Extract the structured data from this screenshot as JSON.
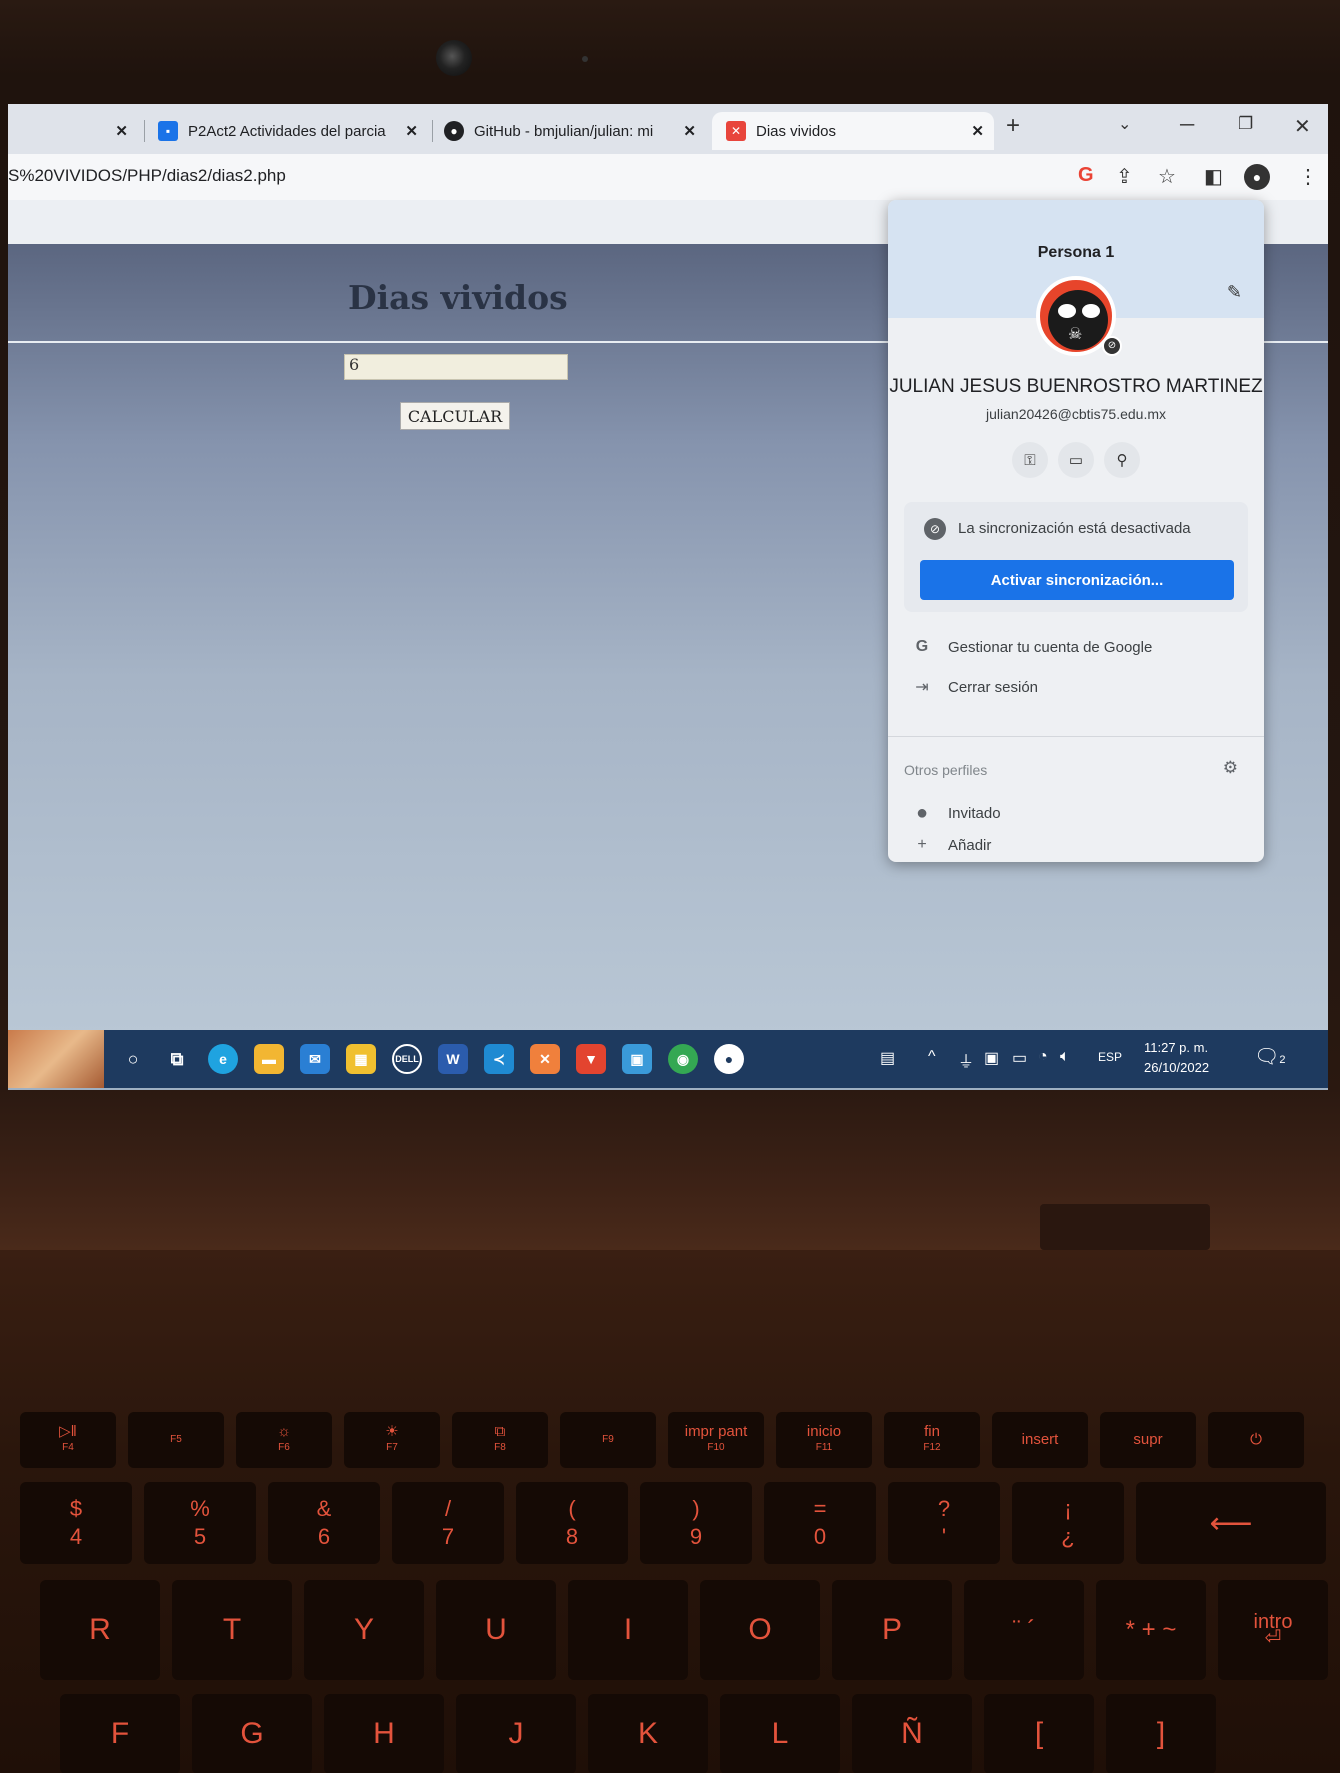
{
  "browser": {
    "tabs": [
      {
        "label": ""
      },
      {
        "label": "P2Act2 Actividades del parcia"
      },
      {
        "label": "GitHub - bmjulian/julian: mi"
      },
      {
        "label": "Dias vividos"
      }
    ],
    "new_tab": "+",
    "url": "S%20VIVIDOS/PHP/dias2/dias2.php"
  },
  "page": {
    "title": "Dias vividos",
    "input_value": "6",
    "button_label": "CALCULAR"
  },
  "profile_menu": {
    "profile_name": "Persona 1",
    "full_name": "JULIAN JESUS BUENROSTRO MARTINEZ",
    "email": "julian20426@cbtis75.edu.mx",
    "sync_status": "La sincronización está desactivada",
    "sync_button": "Activar sincronización...",
    "manage_account": "Gestionar tu cuenta de Google",
    "sign_out": "Cerrar sesión",
    "other_profiles": "Otros perfiles",
    "guest": "Invitado",
    "add": "Añadir"
  },
  "taskbar": {
    "language": "ESP",
    "time": "11:27 p. m.",
    "date": "26/10/2022",
    "notifications": "2"
  },
  "keyboard": {
    "fn_row": [
      "F4",
      "F5",
      "F6",
      "F7",
      "F8",
      "F9",
      "impr pant",
      "inicio",
      "fin",
      "insert",
      "supr"
    ],
    "fn_sub": [
      "F10",
      "F11",
      "F12"
    ],
    "num_row": [
      "4",
      "5",
      "6",
      "7",
      "8",
      "9",
      "0",
      "'",
      "¿"
    ],
    "num_shift": [
      "$",
      "%",
      "&",
      "/",
      "(",
      ")",
      "=",
      "?",
      "¡"
    ],
    "top_row": [
      "R",
      "T",
      "Y",
      "U",
      "I",
      "O",
      "P"
    ],
    "home_row": [
      "F",
      "G",
      "H",
      "J",
      "K",
      "L",
      "Ñ"
    ],
    "enter": "intro"
  },
  "colors": {
    "sync_button": "#1a73e8",
    "keyboard_legend": "#e3533c",
    "taskbar": "#1e3a5f"
  }
}
